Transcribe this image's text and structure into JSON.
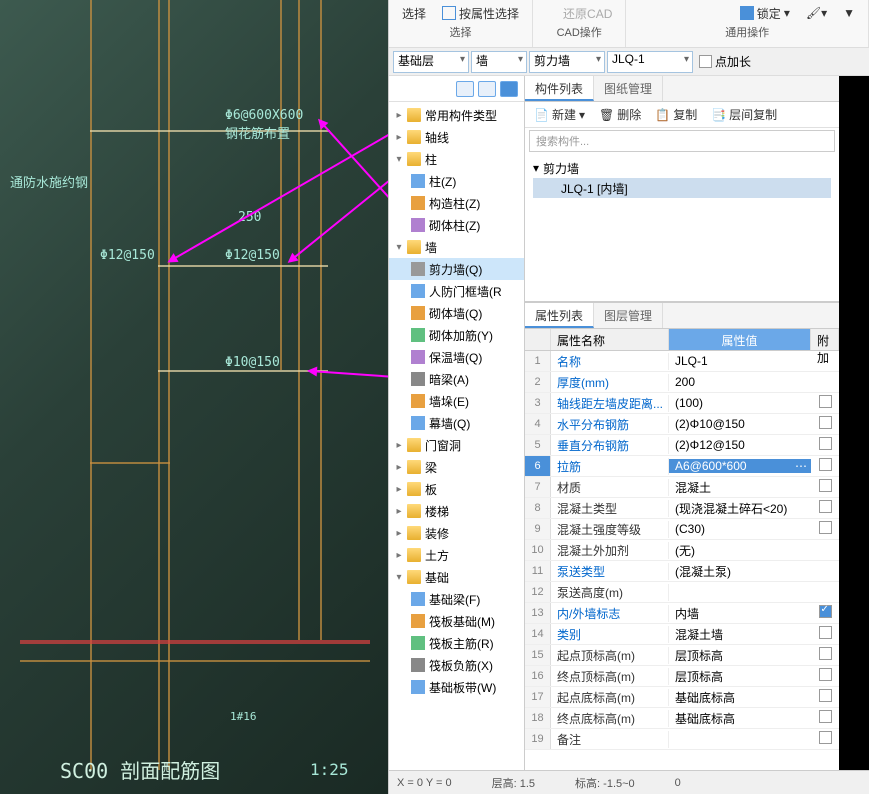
{
  "ribbon": {
    "select": "选择",
    "select_by_attr": "按属性选择",
    "restore_cad": "还原CAD",
    "lock": "锁定",
    "select_group": "选择",
    "cad_group": "CAD操作",
    "general_group": "通用操作"
  },
  "combos": {
    "floor": "基础层",
    "cat": "墙",
    "type": "剪力墙",
    "name": "JLQ-1",
    "extra": "点加长"
  },
  "tree": {
    "common": "常用构件类型",
    "axis": "轴线",
    "column": "柱",
    "col_z": "柱(Z)",
    "col_gz": "构造柱(Z)",
    "col_qt": "砌体柱(Z)",
    "wall": "墙",
    "wall_jl": "剪力墙(Q)",
    "wall_rf": "人防门框墙(R",
    "wall_qt": "砌体墙(Q)",
    "wall_jj": "砌体加筋(Y)",
    "wall_bw": "保温墙(Q)",
    "wall_al": "暗梁(A)",
    "wall_qd": "墙垛(E)",
    "wall_mq": "幕墙(Q)",
    "opening": "门窗洞",
    "beam": "梁",
    "slab": "板",
    "stair": "楼梯",
    "deco": "装修",
    "earth": "土方",
    "found": "基础",
    "f_jcl": "基础梁(F)",
    "f_fbj": "筏板基础(M)",
    "f_fbz": "筏板主筋(R)",
    "f_fbf": "筏板负筋(X)",
    "f_jcb": "基础板带(W)"
  },
  "comp": {
    "tab_list": "构件列表",
    "tab_draw": "图纸管理",
    "new": "新建",
    "delete": "删除",
    "copy": "复制",
    "layer_copy": "层间复制",
    "search_ph": "搜索构件...",
    "root": "剪力墙",
    "item": "JLQ-1 [内墙]"
  },
  "prop": {
    "tab_list": "属性列表",
    "tab_layer": "图层管理",
    "hdr_name": "属性名称",
    "hdr_val": "属性值",
    "hdr_ext": "附加",
    "rows": [
      {
        "i": "1",
        "n": "名称",
        "v": "JLQ-1",
        "link": true
      },
      {
        "i": "2",
        "n": "厚度(mm)",
        "v": "200",
        "link": true
      },
      {
        "i": "3",
        "n": "轴线距左墙皮距离...",
        "v": "(100)",
        "link": true,
        "chk": false
      },
      {
        "i": "4",
        "n": "水平分布钢筋",
        "v": "(2)Φ10@150",
        "link": true,
        "chk": false
      },
      {
        "i": "5",
        "n": "垂直分布钢筋",
        "v": "(2)Φ12@150",
        "link": true,
        "chk": false
      },
      {
        "i": "6",
        "n": "拉筋",
        "v": "A6@600*600",
        "link": true,
        "sel": true,
        "chk": false
      },
      {
        "i": "7",
        "n": "材质",
        "v": "混凝土",
        "chk": false
      },
      {
        "i": "8",
        "n": "混凝土类型",
        "v": "(现浇混凝土碎石<20)",
        "chk": false
      },
      {
        "i": "9",
        "n": "混凝土强度等级",
        "v": "(C30)",
        "chk": false
      },
      {
        "i": "10",
        "n": "混凝土外加剂",
        "v": "(无)"
      },
      {
        "i": "11",
        "n": "泵送类型",
        "v": "(混凝土泵)",
        "link": true
      },
      {
        "i": "12",
        "n": "泵送高度(m)",
        "v": ""
      },
      {
        "i": "13",
        "n": "内/外墙标志",
        "v": "内墙",
        "link": true,
        "chk": true
      },
      {
        "i": "14",
        "n": "类别",
        "v": "混凝土墙",
        "link": true,
        "chk": false
      },
      {
        "i": "15",
        "n": "起点顶标高(m)",
        "v": "层顶标高",
        "chk": false
      },
      {
        "i": "16",
        "n": "终点顶标高(m)",
        "v": "层顶标高",
        "chk": false
      },
      {
        "i": "17",
        "n": "起点底标高(m)",
        "v": "基础底标高",
        "chk": false
      },
      {
        "i": "18",
        "n": "终点底标高(m)",
        "v": "基础底标高",
        "chk": false
      },
      {
        "i": "19",
        "n": "备注",
        "v": "",
        "chk": false
      }
    ]
  },
  "cad_labels": {
    "l1": "Φ6@600X600",
    "l1b": "钢花筋布置",
    "l2": "通防水施约钢",
    "l3": "250",
    "l4": "Φ12@150",
    "l5": "Φ12@150",
    "l6": "Φ10@150",
    "l7": "1#16",
    "title": "SC00 剖面配筋图",
    "scale": "1:25"
  },
  "status": {
    "xy": "X = 0 Y = 0",
    "floor_h": "层高:   1.5",
    "elev": "标高: -1.5~0",
    "zero": "0"
  }
}
